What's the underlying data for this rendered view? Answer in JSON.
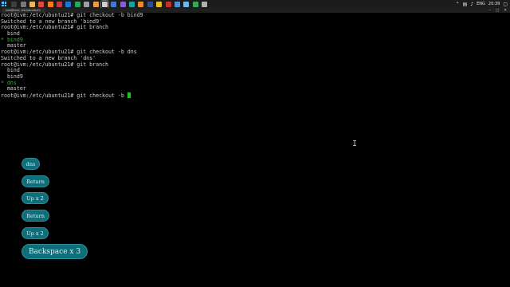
{
  "taskbar": {
    "tray": {
      "language": "ENG",
      "time": "20:39"
    },
    "apps": [
      {
        "name": "search",
        "color": "#3f3f3f"
      },
      {
        "name": "task-view",
        "color": "#777777"
      },
      {
        "name": "file-explorer",
        "color": "#e8b84a"
      },
      {
        "name": "chrome",
        "color": "#e04a3b"
      },
      {
        "name": "firefox",
        "color": "#ff7b1a"
      },
      {
        "name": "app-red",
        "color": "#d13438"
      },
      {
        "name": "app-blue",
        "color": "#1e73d6"
      },
      {
        "name": "app-green",
        "color": "#2aa55a"
      },
      {
        "name": "app-grey",
        "color": "#9aa0a6"
      },
      {
        "name": "app-orange",
        "color": "#f29b30"
      },
      {
        "name": "terminal",
        "color": "#cfcfcf"
      },
      {
        "name": "app-blue-2",
        "color": "#3a7bd5"
      },
      {
        "name": "app-purple",
        "color": "#8a5cd6"
      },
      {
        "name": "app-teal",
        "color": "#1aa39b"
      },
      {
        "name": "vlc",
        "color": "#f08a1c"
      },
      {
        "name": "app-darkblue",
        "color": "#2b4fa0"
      },
      {
        "name": "app-yellow",
        "color": "#e3c02b"
      },
      {
        "name": "app-red-2",
        "color": "#c9302c"
      },
      {
        "name": "app-blue-3",
        "color": "#4a90e2"
      },
      {
        "name": "app-lightblue",
        "color": "#6fb6ea"
      },
      {
        "name": "app-green-2",
        "color": "#34a853"
      },
      {
        "name": "app-grey-2",
        "color": "#b0b0b0"
      }
    ]
  },
  "window": {
    "title": "root@ivm: /etc/ubuntu21"
  },
  "terminal": {
    "lines": [
      {
        "text": "root@ivm:/etc/ubuntu21# git checkout -b bind9",
        "style": "normal"
      },
      {
        "text": "Switched to a new branch 'bind9'",
        "style": "normal"
      },
      {
        "text": "root@ivm:/etc/ubuntu21# git branch",
        "style": "normal"
      },
      {
        "text": "  bind",
        "style": "normal"
      },
      {
        "text": "* bind9",
        "style": "green"
      },
      {
        "text": "  master",
        "style": "normal"
      },
      {
        "text": "root@ivm:/etc/ubuntu21# git checkout -b dns",
        "style": "normal"
      },
      {
        "text": "Switched to a new branch 'dns'",
        "style": "normal"
      },
      {
        "text": "root@ivm:/etc/ubuntu21# git branch",
        "style": "normal"
      },
      {
        "text": "  bind",
        "style": "normal"
      },
      {
        "text": "  bind9",
        "style": "normal"
      },
      {
        "text": "* dns",
        "style": "green"
      },
      {
        "text": "  master",
        "style": "normal"
      },
      {
        "text": "root@ivm:/etc/ubuntu21# git checkout -b ",
        "style": "prompt"
      }
    ]
  },
  "keypresses": [
    {
      "label": "dns"
    },
    {
      "label": "Return"
    },
    {
      "label": "Up x 2"
    },
    {
      "label": "Return"
    },
    {
      "label": "Up x 2"
    },
    {
      "label": "Backspace x 3"
    }
  ],
  "colors": {
    "terminal_bg": "#000000",
    "terminal_fg": "#d0d0d0",
    "branch_highlight": "#2fb52f",
    "key_bg": "#0f6e7a"
  }
}
